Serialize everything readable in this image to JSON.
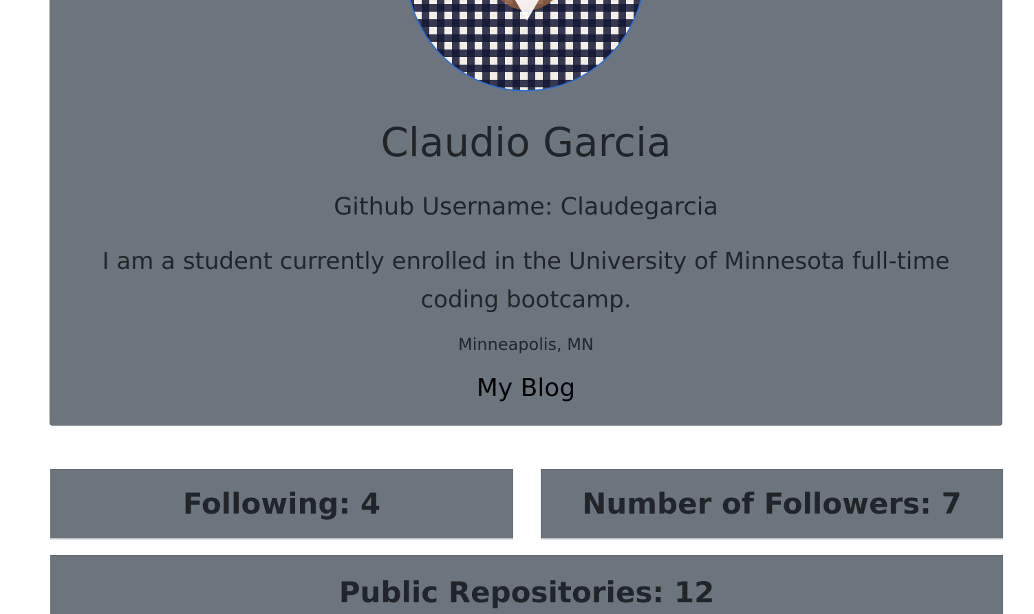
{
  "profile": {
    "name": "Claudio Garcia",
    "username": "Github Username: Claudegarcia",
    "bio": "I am a student currently enrolled in the University of Minnesota full-time coding bootcamp.",
    "location": "Minneapolis, MN",
    "blog_label": "My Blog"
  },
  "stats": {
    "following": "Following: 4",
    "followers": "Number of Followers: 7",
    "repos": "Public Repositories: 12"
  },
  "colors": {
    "card_background": "#6c757d",
    "text": "#212529",
    "avatar_border": "#2f6fcf"
  }
}
